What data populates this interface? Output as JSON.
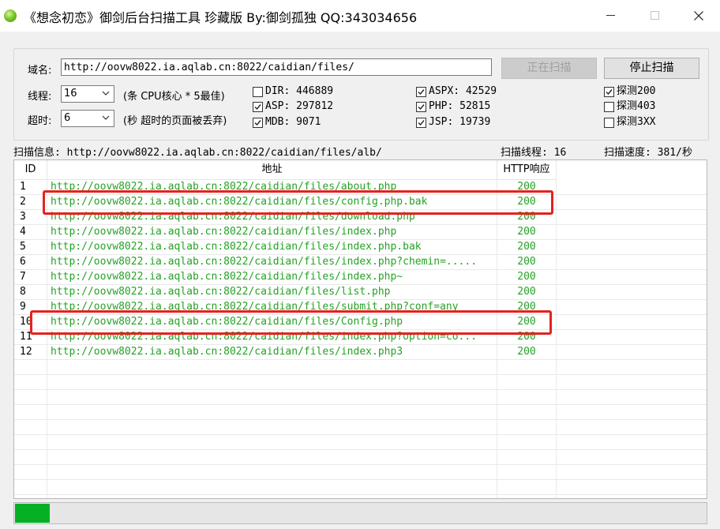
{
  "window": {
    "title": "《想念初恋》御剑后台扫描工具 珍藏版 By:御剑孤独 QQ:343034656",
    "icon": "green-ball-icon"
  },
  "form": {
    "domain_label": "域名:",
    "domain_value": "http://oovw8022.ia.aqlab.cn:8022/caidian/files/",
    "scan_button": "正在扫描",
    "stop_button": "停止扫描",
    "threads_label": "线程:",
    "threads_value": "16",
    "threads_hint": "(条 CPU核心 * 5最佳)",
    "timeout_label": "超时:",
    "timeout_value": "6",
    "timeout_hint": "(秒 超时的页面被丢弃)"
  },
  "dicts": [
    {
      "label": "DIR: 446889",
      "checked": false
    },
    {
      "label": "ASP: 297812",
      "checked": true
    },
    {
      "label": "MDB: 9071",
      "checked": true
    },
    {
      "label": "ASPX: 42529",
      "checked": true
    },
    {
      "label": "PHP: 52815",
      "checked": true
    },
    {
      "label": "JSP: 19739",
      "checked": true
    },
    {
      "label": "探测200",
      "checked": true
    },
    {
      "label": "探测403",
      "checked": false
    },
    {
      "label": "探测3XX",
      "checked": false
    }
  ],
  "status": {
    "scan_info": "扫描信息: http://oovw8022.ia.aqlab.cn:8022/caidian/files/alb/",
    "threads": "扫描线程: 16",
    "speed": "扫描速度: 381/秒"
  },
  "table": {
    "headers": [
      "ID",
      "地址",
      "HTTP响应"
    ],
    "rows": [
      {
        "id": "1",
        "url": "http://oovw8022.ia.aqlab.cn:8022/caidian/files/about.php",
        "code": "200"
      },
      {
        "id": "2",
        "url": "http://oovw8022.ia.aqlab.cn:8022/caidian/files/config.php.bak",
        "code": "200"
      },
      {
        "id": "3",
        "url": "http://oovw8022.ia.aqlab.cn:8022/caidian/files/download.php",
        "code": "200"
      },
      {
        "id": "4",
        "url": "http://oovw8022.ia.aqlab.cn:8022/caidian/files/index.php",
        "code": "200"
      },
      {
        "id": "5",
        "url": "http://oovw8022.ia.aqlab.cn:8022/caidian/files/index.php.bak",
        "code": "200"
      },
      {
        "id": "6",
        "url": "http://oovw8022.ia.aqlab.cn:8022/caidian/files/index.php?chemin=.....",
        "code": "200"
      },
      {
        "id": "7",
        "url": "http://oovw8022.ia.aqlab.cn:8022/caidian/files/index.php~",
        "code": "200"
      },
      {
        "id": "8",
        "url": "http://oovw8022.ia.aqlab.cn:8022/caidian/files/list.php",
        "code": "200"
      },
      {
        "id": "9",
        "url": "http://oovw8022.ia.aqlab.cn:8022/caidian/files/submit.php?conf=any",
        "code": "200"
      },
      {
        "id": "10",
        "url": "http://oovw8022.ia.aqlab.cn:8022/caidian/files/Config.php",
        "code": "200"
      },
      {
        "id": "11",
        "url": "http://oovw8022.ia.aqlab.cn:8022/caidian/files/index.php?option=co...",
        "code": "200"
      },
      {
        "id": "12",
        "url": "http://oovw8022.ia.aqlab.cn:8022/caidian/files/index.php3",
        "code": "200"
      }
    ],
    "highlighted_ids": [
      "2",
      "10"
    ]
  },
  "progress": {
    "fraction": 0.05
  },
  "colors": {
    "url_green": "#25a225",
    "highlight_red": "#e4221e",
    "progress_green": "#06b025"
  }
}
